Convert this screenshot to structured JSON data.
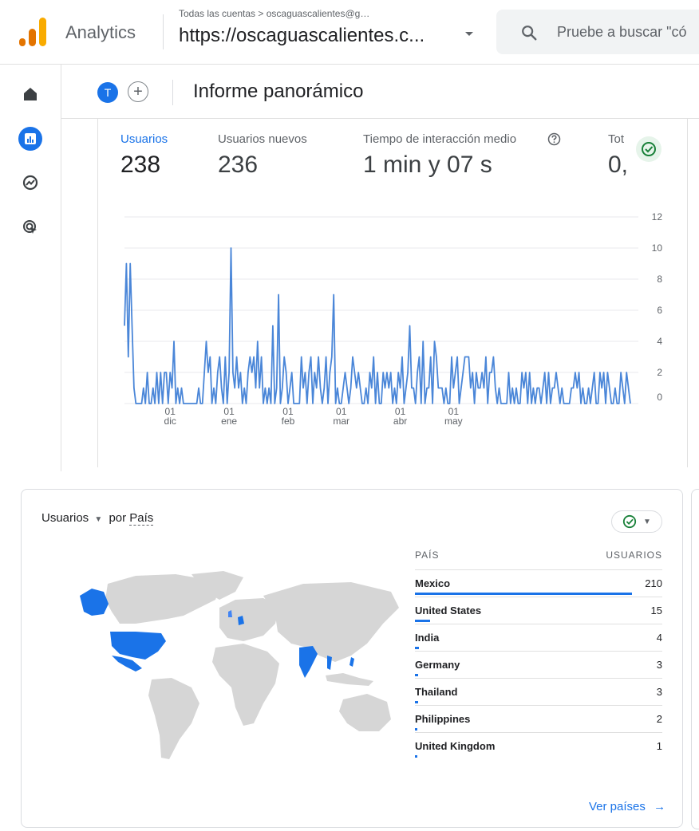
{
  "topbar": {
    "app_name": "Analytics",
    "breadcrumb": "Todas las cuentas > oscaguascalientes@g…",
    "account": "https://oscaguascalientes.c...",
    "search_placeholder": "Pruebe a buscar \"có"
  },
  "header": {
    "avatar_letter": "T",
    "add_symbol": "+",
    "title": "Informe panorámico"
  },
  "metrics": [
    {
      "label": "Usuarios",
      "value": "238",
      "active": true
    },
    {
      "label": "Usuarios nuevos",
      "value": "236"
    },
    {
      "label": "Tiempo de interacción medio",
      "value": "1 min y 07 s",
      "has_help": true
    },
    {
      "label": "Tot",
      "value": "0,"
    }
  ],
  "colors": {
    "accent": "#1a73e8",
    "line": "#4a86d8",
    "map_highlight": "#1a73e8",
    "map_light": "#4285f4",
    "land": "#d6d6d6",
    "check": "#188038"
  },
  "chart_data": {
    "type": "line",
    "title": "",
    "xlabel": "",
    "ylabel": "",
    "x_tick_labels": [
      [
        "01",
        "dic"
      ],
      [
        "01",
        "ene"
      ],
      [
        "01",
        "feb"
      ],
      [
        "01",
        "mar"
      ],
      [
        "01",
        "abr"
      ],
      [
        "01",
        "may"
      ]
    ],
    "y_ticks": [
      0,
      2,
      4,
      6,
      8,
      10,
      12
    ],
    "ylim": [
      0,
      12
    ],
    "grid": true,
    "series": [
      {
        "values": [
          5,
          9,
          3,
          9,
          5,
          1,
          0,
          0,
          0,
          0,
          1,
          0,
          2,
          0,
          0,
          1,
          0,
          2,
          0,
          2,
          0,
          2,
          2,
          0,
          2,
          1,
          4,
          0,
          1,
          0,
          1,
          0,
          0,
          0,
          0,
          0,
          0,
          0,
          0,
          1,
          0,
          0,
          2,
          4,
          2,
          3,
          0,
          1,
          0,
          2,
          3,
          1,
          0,
          3,
          0,
          2,
          10,
          2,
          1,
          3,
          1,
          2,
          0,
          1,
          0,
          2,
          3,
          2,
          3,
          1,
          4,
          1,
          3,
          0,
          1,
          0,
          1,
          0,
          5,
          0,
          1,
          7,
          0,
          1,
          3,
          2,
          0,
          1,
          2,
          0,
          0,
          0,
          0,
          3,
          1,
          2,
          0,
          2,
          3,
          0,
          2,
          1,
          3,
          1,
          0,
          1,
          3,
          0,
          2,
          3,
          7,
          0,
          1,
          0,
          0,
          1,
          2,
          1,
          0,
          1,
          3,
          2,
          1,
          2,
          1,
          0,
          0,
          1,
          0,
          2,
          1,
          3,
          0,
          2,
          0,
          0,
          2,
          1,
          2,
          1,
          2,
          0,
          1,
          0,
          2,
          1,
          3,
          0,
          1,
          2,
          5,
          1,
          1,
          0,
          2,
          3,
          0,
          4,
          0,
          1,
          1,
          3,
          0,
          4,
          3,
          1,
          1,
          1,
          0,
          1,
          0,
          0,
          3,
          1,
          2,
          3,
          0,
          1,
          2,
          3,
          3,
          3,
          1,
          2,
          0,
          2,
          1,
          1,
          2,
          1,
          3,
          0,
          2,
          2,
          3,
          1,
          0,
          1,
          0,
          0,
          0,
          0,
          2,
          0,
          1,
          0,
          1,
          0,
          0,
          2,
          1,
          2,
          0,
          2,
          0,
          1,
          0,
          1,
          1,
          0,
          1,
          2,
          0,
          2,
          0,
          1,
          1,
          2,
          1,
          0,
          1,
          0,
          0,
          0,
          0,
          1,
          1,
          2,
          1,
          2,
          0,
          1,
          0,
          0,
          1,
          0,
          1,
          2,
          0,
          0,
          2,
          1,
          2,
          0,
          2,
          1,
          0,
          0,
          1,
          0,
          0,
          2,
          1,
          0,
          2,
          1,
          0
        ]
      }
    ]
  },
  "country_card": {
    "metric": "Usuarios",
    "by": "por",
    "dimension": "País",
    "col_country": "PAÍS",
    "col_users": "USUARIOS",
    "rows": [
      {
        "country": "Mexico",
        "users": "210",
        "share": 1.0
      },
      {
        "country": "United States",
        "users": "15",
        "share": 0.071
      },
      {
        "country": "India",
        "users": "4",
        "share": 0.019
      },
      {
        "country": "Germany",
        "users": "3",
        "share": 0.014
      },
      {
        "country": "Thailand",
        "users": "3",
        "share": 0.014
      },
      {
        "country": "Philippines",
        "users": "2",
        "share": 0.01
      },
      {
        "country": "United Kingdom",
        "users": "1",
        "share": 0.005
      }
    ],
    "link": "Ver países",
    "link_arrow": "→"
  },
  "icons": [
    "analytics-logo",
    "search-icon",
    "home-icon",
    "reports-icon",
    "explore-icon",
    "advertising-icon",
    "help-icon",
    "check-icon",
    "dropdown-arrow-icon"
  ]
}
